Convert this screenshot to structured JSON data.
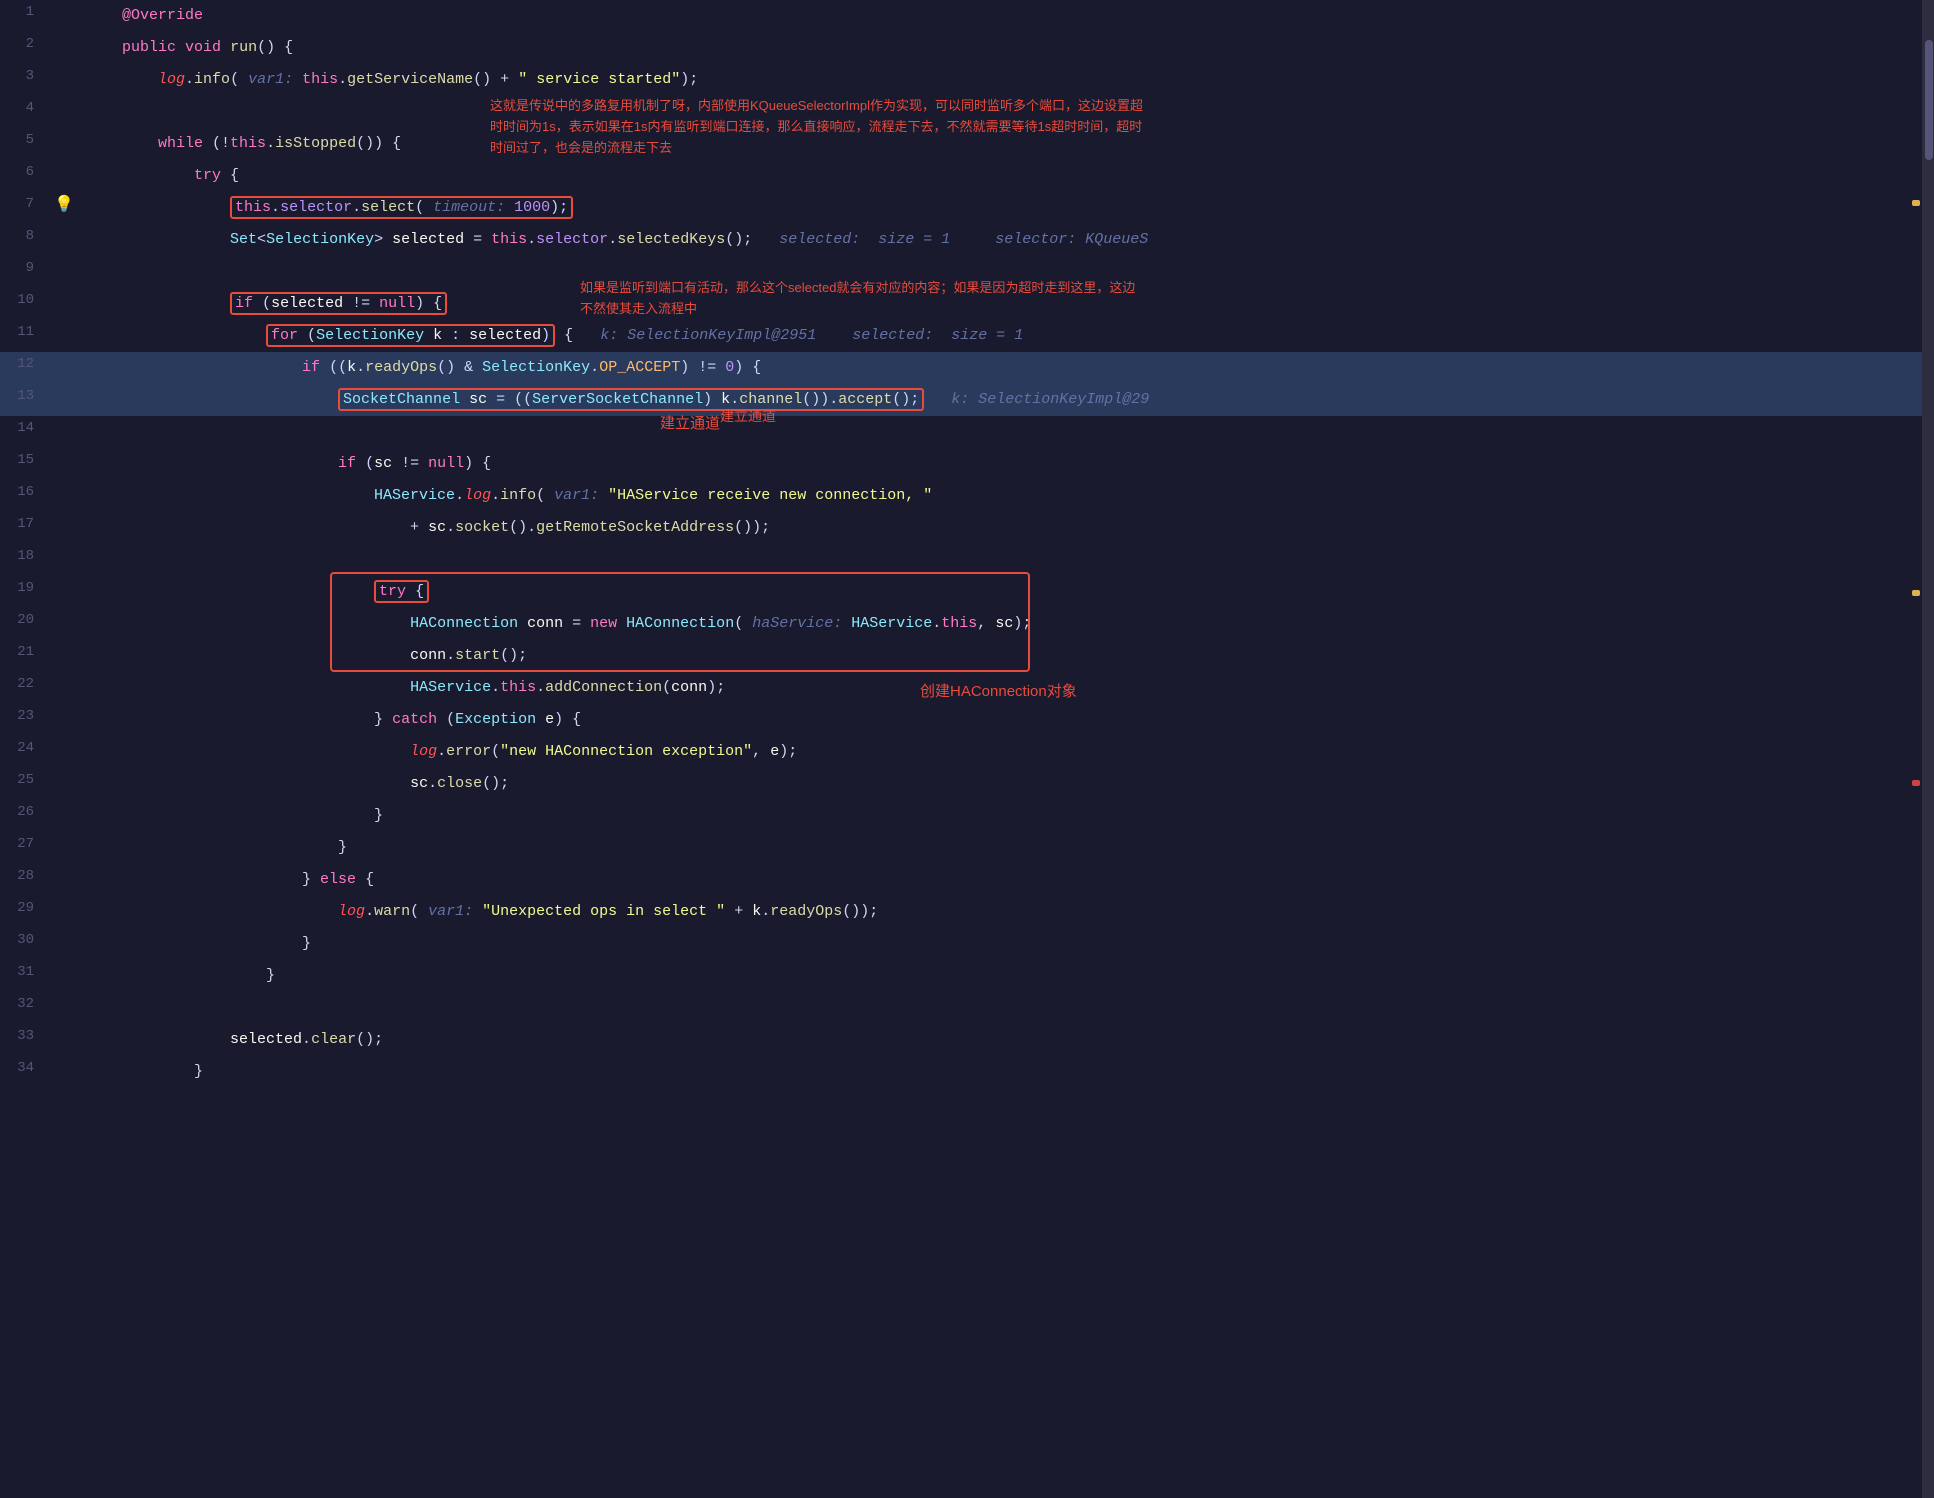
{
  "editor": {
    "background": "#1a1a2e",
    "highlighted_line": 12
  },
  "lines": [
    {
      "num": 1,
      "indent": 2,
      "tokens": "@Override",
      "type": "annotation"
    },
    {
      "num": 2,
      "tokens": "public void run() {"
    },
    {
      "num": 3,
      "indent": 8,
      "tokens": "log.info( var1: this.getServiceName() + \" service started\");"
    },
    {
      "num": 4,
      "tokens": ""
    },
    {
      "num": 5,
      "indent": 8,
      "tokens": "while (!this.isStopped()) {"
    },
    {
      "num": 6,
      "indent": 12,
      "tokens": "try {"
    },
    {
      "num": 7,
      "indent": 16,
      "tokens": "this.selector.select( timeout: 1000);"
    },
    {
      "num": 8,
      "indent": 16,
      "tokens": "Set<SelectionKey> selected = this.selector.selectedKeys();   selected:  size = 1     selector: KQueueS"
    },
    {
      "num": 9,
      "tokens": ""
    },
    {
      "num": 10,
      "indent": 16,
      "tokens": "if (selected != null) {"
    },
    {
      "num": 11,
      "indent": 20,
      "tokens": "for (SelectionKey k : selected) {   k: SelectionKeyImpl@2951    selected:  size = 1"
    },
    {
      "num": 12,
      "indent": 24,
      "tokens": "if ((k.readyOps() & SelectionKey.OP_ACCEPT) != 0) {",
      "highlighted": true
    },
    {
      "num": 13,
      "indent": 28,
      "tokens": "SocketChannel sc = ((ServerSocketChannel) k.channel()).accept();   k: SelectionKeyImpl@29",
      "highlighted": true
    },
    {
      "num": 14,
      "tokens": ""
    },
    {
      "num": 15,
      "indent": 28,
      "tokens": "if (sc != null) {"
    },
    {
      "num": 16,
      "indent": 32,
      "tokens": "HAService.log.info( var1: \"HAService receive new connection, \""
    },
    {
      "num": 17,
      "indent": 36,
      "tokens": "+ sc.socket().getRemoteSocketAddress());"
    },
    {
      "num": 18,
      "tokens": ""
    },
    {
      "num": 19,
      "indent": 32,
      "tokens": "try {"
    },
    {
      "num": 20,
      "indent": 36,
      "tokens": "HAConnection conn = new HAConnection( haService: HAService.this, sc);"
    },
    {
      "num": 21,
      "indent": 36,
      "tokens": "conn.start();"
    },
    {
      "num": 22,
      "indent": 36,
      "tokens": "HAService.this.addConnection(conn);"
    },
    {
      "num": 23,
      "indent": 32,
      "tokens": "} catch (Exception e) {"
    },
    {
      "num": 24,
      "indent": 36,
      "tokens": "log.error(\"new HAConnection exception\", e);"
    },
    {
      "num": 25,
      "indent": 36,
      "tokens": "sc.close();"
    },
    {
      "num": 26,
      "indent": 32,
      "tokens": "}"
    },
    {
      "num": 27,
      "indent": 28,
      "tokens": "}"
    },
    {
      "num": 28,
      "indent": 24,
      "tokens": "} else {"
    },
    {
      "num": 29,
      "indent": 28,
      "tokens": "log.warn( var1: \"Unexpected ops in select \" + k.readyOps());"
    },
    {
      "num": 30,
      "indent": 24,
      "tokens": "}"
    },
    {
      "num": 31,
      "indent": 20,
      "tokens": "}"
    },
    {
      "num": 32,
      "tokens": ""
    },
    {
      "num": 33,
      "indent": 16,
      "tokens": "selected.clear();"
    },
    {
      "num": 34,
      "indent": 12,
      "tokens": "}"
    }
  ],
  "tooltips": {
    "top_right": "这就是传说中的多路复用机制了呀，内部使用KQueueSelectorImpl作为实现，可以同时监听多个端口，这边设置超时时间为1s，表示如果在1s内有监听到端口连接，那么直接响应，流程走下去，不然就需要等待1s超时时间，超时时间过了，也会是的流程走下去",
    "middle_right": "如果是监听到端口有活动，那么这个selected就会有对应的内容；如果是因为超时走到这里，这边不然使其走入流程中",
    "build_channel": "建立通道",
    "create_ha": "创建HAConnection对象"
  }
}
